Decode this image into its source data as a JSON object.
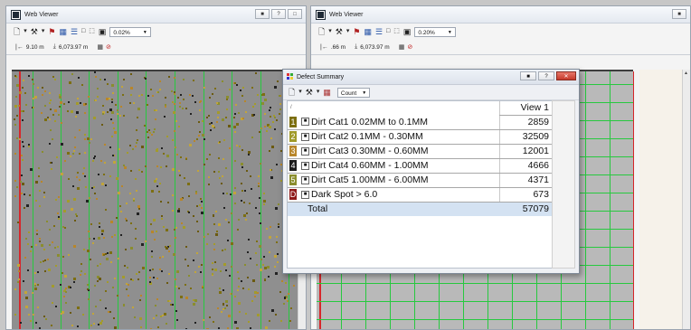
{
  "left_viewer": {
    "title": "Web Viewer",
    "zoom": "0.02%",
    "scale": "9.10 m",
    "position": "6,073.97 m"
  },
  "right_viewer": {
    "title": "Web Viewer",
    "zoom": "0.20%",
    "scale": ".66 m",
    "position": "6,073.97 m"
  },
  "dialog": {
    "title": "Defect Summary",
    "count_select": "Count",
    "column_header": "View 1",
    "rows": [
      {
        "swatch": "1",
        "color": "#7c6f10",
        "label": "Dirt Cat1 0.02MM to 0.1MM",
        "value": "2859"
      },
      {
        "swatch": "2",
        "color": "#a09a2a",
        "label": "Dirt Cat2  0.1MM - 0.30MM",
        "value": "32509"
      },
      {
        "swatch": "3",
        "color": "#b8862a",
        "label": "Dirt Cat3  0.30MM - 0.60MM",
        "value": "12001"
      },
      {
        "swatch": "4",
        "color": "#1a1a1a",
        "label": "Dirt Cat4 0.60MM - 1.00MM",
        "value": "4666"
      },
      {
        "swatch": "5",
        "color": "#8a8d2e",
        "label": "Dirt Cat5 1.00MM - 6.00MM",
        "value": "4371"
      },
      {
        "swatch": "D",
        "color": "#8e1a1a",
        "label": "Dark Spot > 6.0",
        "value": "673"
      }
    ],
    "total_label": "Total",
    "total_value": "57079"
  },
  "colors": {
    "grid_green": "#27c93f",
    "edge_red": "#d7262b"
  }
}
